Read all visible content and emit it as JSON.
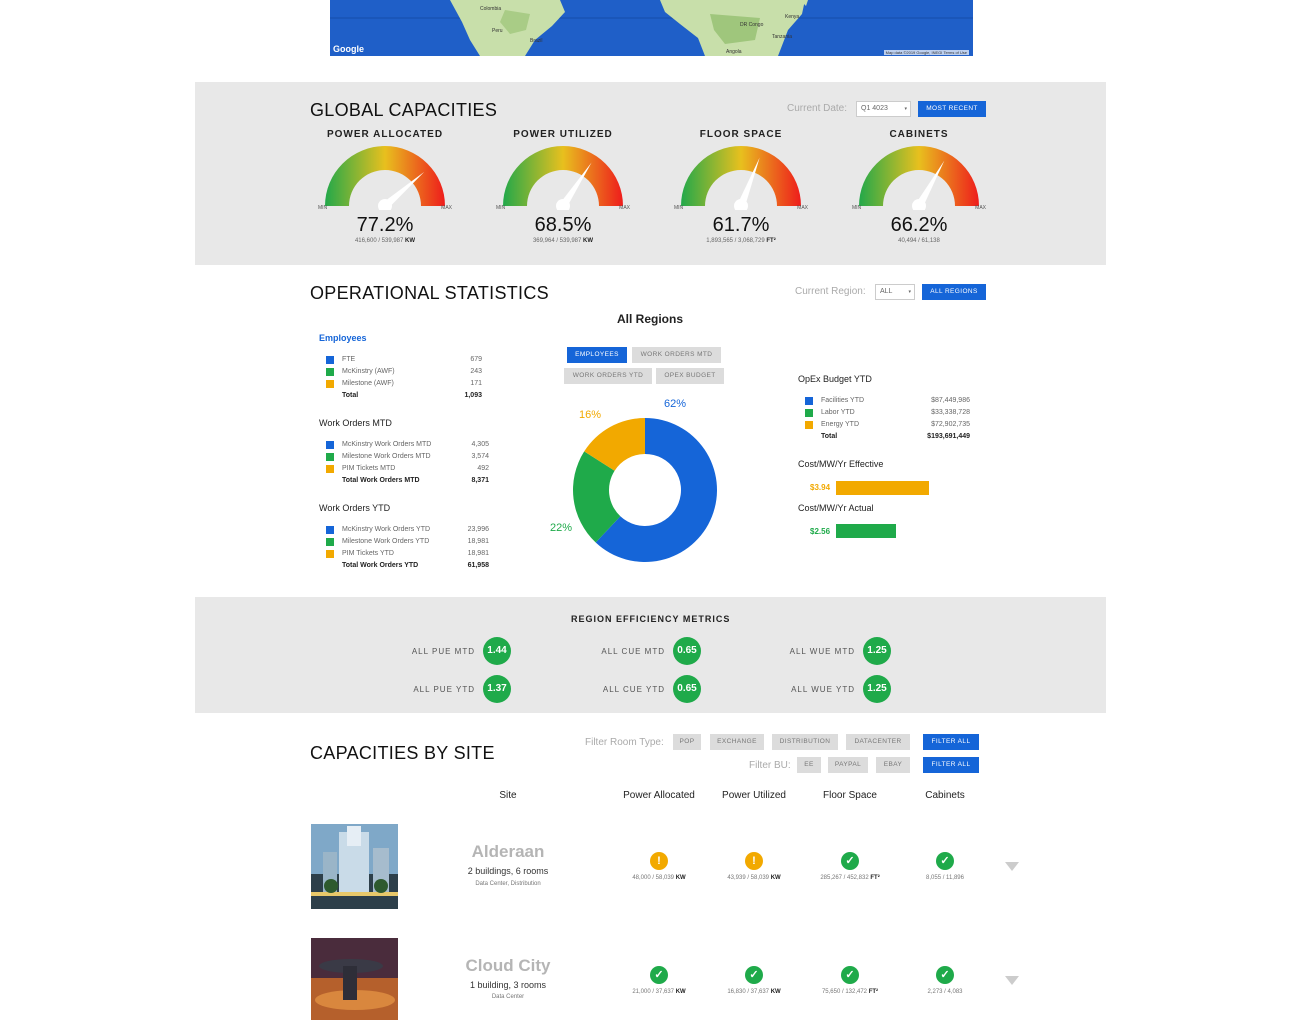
{
  "map": {
    "google_label": "Google",
    "credit": "Map data ©2019 Google, INEGI   Terms of Use",
    "labels": [
      "Colombia",
      "Brazil",
      "Peru",
      "DR Congo",
      "Kenya",
      "Tanzania",
      "Angola"
    ]
  },
  "global": {
    "title": "GLOBAL CAPACITIES",
    "date_label": "Current Date:",
    "date_value": "Q1 4023",
    "most_recent": "MOST RECENT",
    "min": "MIN",
    "max": "MAX",
    "gauges": [
      {
        "title": "POWER ALLOCATED",
        "value": "77.2%",
        "fraction": 0.772,
        "sub": "416,600 / 539,987",
        "unit": "KW"
      },
      {
        "title": "POWER UTILIZED",
        "value": "68.5%",
        "fraction": 0.685,
        "sub": "369,964 / 539,987",
        "unit": "KW"
      },
      {
        "title": "FLOOR SPACE",
        "value": "61.7%",
        "fraction": 0.617,
        "sub": "1,893,565 / 3,068,729",
        "unit": "FT²"
      },
      {
        "title": "CABINETS",
        "value": "66.2%",
        "fraction": 0.662,
        "sub": "40,494 / 61,138",
        "unit": ""
      }
    ]
  },
  "operational": {
    "title": "OPERATIONAL STATISTICS",
    "region_label": "Current Region:",
    "region_value": "ALL",
    "all_regions": "ALL REGIONS",
    "employees": {
      "heading": "Employees",
      "rows": [
        {
          "label": "FTE",
          "value": "679",
          "color": "#1565d8"
        },
        {
          "label": "McKinstry (AWF)",
          "value": "243",
          "color": "#1faa4a"
        },
        {
          "label": "Milestone (AWF)",
          "value": "171",
          "color": "#f2a900"
        }
      ],
      "total_label": "Total",
      "total_value": "1,093"
    },
    "wo_mtd": {
      "heading": "Work Orders MTD",
      "rows": [
        {
          "label": "McKinstry Work Orders MTD",
          "value": "4,305",
          "color": "#1565d8"
        },
        {
          "label": "Milestone Work Orders MTD",
          "value": "3,574",
          "color": "#1faa4a"
        },
        {
          "label": "PIM Tickets MTD",
          "value": "492",
          "color": "#f2a900"
        }
      ],
      "total_label": "Total Work Orders MTD",
      "total_value": "8,371"
    },
    "wo_ytd": {
      "heading": "Work Orders YTD",
      "rows": [
        {
          "label": "McKinstry Work Orders YTD",
          "value": "23,996",
          "color": "#1565d8"
        },
        {
          "label": "Milestone Work Orders YTD",
          "value": "18,981",
          "color": "#1faa4a"
        },
        {
          "label": "PIM Tickets YTD",
          "value": "18,981",
          "color": "#f2a900"
        }
      ],
      "total_label": "Total Work Orders YTD",
      "total_value": "61,958"
    },
    "chart_title": "All Regions",
    "tabs": [
      "EMPLOYEES",
      "WORK ORDERS MTD",
      "WORK ORDERS YTD",
      "OPEX BUDGET"
    ],
    "opex": {
      "heading": "OpEx Budget YTD",
      "rows": [
        {
          "label": "Facilities YTD",
          "value": "$87,449,986",
          "color": "#1565d8"
        },
        {
          "label": "Labor YTD",
          "value": "$33,338,728",
          "color": "#1faa4a"
        },
        {
          "label": "Energy YTD",
          "value": "$72,902,735",
          "color": "#f2a900"
        }
      ],
      "total_label": "Total",
      "total_value": "$193,691,449"
    },
    "cost_effective": {
      "heading": "Cost/MW/Yr Effective",
      "value": "$3.94",
      "amount": 3.94,
      "color": "#f2a900"
    },
    "cost_actual": {
      "heading": "Cost/MW/Yr Actual",
      "value": "$2.56",
      "amount": 2.56,
      "color": "#1faa4a"
    }
  },
  "chart_data": {
    "type": "pie",
    "title": "All Regions",
    "categories": [
      "FTE",
      "McKinstry (AWF)",
      "Milestone (AWF)"
    ],
    "values": [
      62,
      22,
      16
    ],
    "labels": [
      "62%",
      "22%",
      "16%"
    ],
    "colors": [
      "#1565d8",
      "#1faa4a",
      "#f2a900"
    ]
  },
  "efficiency": {
    "title": "REGION EFFICIENCY METRICS",
    "metrics": [
      {
        "label": "ALL PUE MTD",
        "value": "1.44"
      },
      {
        "label": "ALL CUE MTD",
        "value": "0.65"
      },
      {
        "label": "ALL WUE MTD",
        "value": "1.25"
      },
      {
        "label": "ALL PUE YTD",
        "value": "1.37"
      },
      {
        "label": "ALL CUE YTD",
        "value": "0.65"
      },
      {
        "label": "ALL WUE YTD",
        "value": "1.25"
      }
    ]
  },
  "sites": {
    "title": "CAPACITIES BY SITE",
    "filter_room_label": "Filter Room Type:",
    "room_types": [
      "POP",
      "EXCHANGE",
      "DISTRIBUTION",
      "DATACENTER"
    ],
    "filter_all": "FILTER ALL",
    "filter_bu_label": "Filter BU:",
    "bus": [
      "EE",
      "PAYPAL",
      "EBAY"
    ],
    "columns": [
      "Site",
      "Power Allocated",
      "Power Utilized",
      "Floor Space",
      "Cabinets"
    ],
    "rows": [
      {
        "name": "Alderaan",
        "info": "2 buildings, 6 rooms",
        "type": "Data Center, Distribution",
        "stats": [
          {
            "status": "warn",
            "sub": "48,000 / 58,039",
            "unit": "KW"
          },
          {
            "status": "warn",
            "sub": "43,939 / 58,039",
            "unit": "KW"
          },
          {
            "status": "ok",
            "sub": "285,267 / 452,832",
            "unit": "FT²"
          },
          {
            "status": "ok",
            "sub": "8,055 / 11,896",
            "unit": ""
          }
        ]
      },
      {
        "name": "Cloud City",
        "info": "1 building, 3 rooms",
        "type": "Data Center",
        "stats": [
          {
            "status": "ok",
            "sub": "21,000 / 37,637",
            "unit": "KW"
          },
          {
            "status": "ok",
            "sub": "16,830 / 37,637",
            "unit": "KW"
          },
          {
            "status": "ok",
            "sub": "75,650 / 132,472",
            "unit": "FT²"
          },
          {
            "status": "ok",
            "sub": "2,273 / 4,083",
            "unit": ""
          }
        ]
      }
    ]
  }
}
